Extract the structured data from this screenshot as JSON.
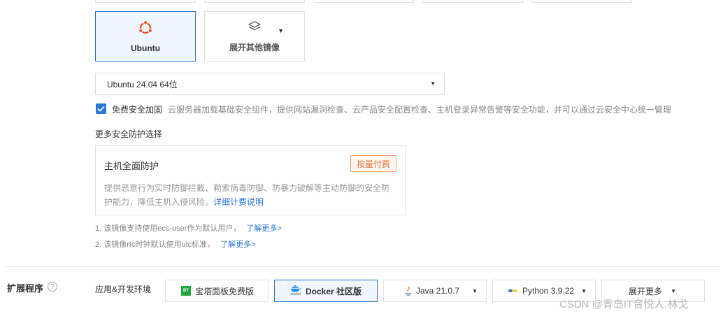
{
  "image_cards": {
    "ubuntu": {
      "label": "Ubuntu",
      "icon": "ubuntu-logo-icon",
      "color": "#e95420"
    },
    "other": {
      "label": "展开其他镜像",
      "icon": "layers-icon"
    }
  },
  "version_select": {
    "value": "Ubuntu 24.04 64位"
  },
  "security": {
    "checkbox_label": "免费安全加固",
    "checked": true,
    "description": "云服务器加载基础安全组件，提供网站漏洞检查、云产品安全配置检查、主机登录异常告警等安全功能，并可以通过云安全中心统一管理"
  },
  "more_protection": {
    "title": "更多安全防护选择",
    "card": {
      "title": "主机全面防护",
      "badge": "按量付费",
      "desc_line1": "提供恶意行为实时防御拦截、勒索病毒防御、防暴力破解等主动防御的安全防",
      "desc_line2": "护能力，降低主机入侵风险。",
      "link": "详细计费说明"
    }
  },
  "notes": [
    {
      "text": "1. 该镜像支持使用ecs-user作为默认用户，",
      "link": "了解更多>"
    },
    {
      "text": "2. 该镜像rtc时钟默认使用utc标准，",
      "link": "了解更多>"
    }
  ],
  "extensions": {
    "title": "扩展程序",
    "help": "?",
    "env_label": "应用&开发环境",
    "items": [
      {
        "label": "宝塔面板免费版",
        "icon_text": "BT"
      },
      {
        "label": "Docker 社区版",
        "icon_text": "docker",
        "selected": true
      },
      {
        "label": "Java 21.0.7"
      },
      {
        "label": "Python 3.9.22"
      },
      {
        "label": "展开更多"
      }
    ]
  },
  "watermark": "CSDN @青岛IT音悦人.林戈",
  "colors": {
    "accent": "#2a75d8",
    "pay_badge": "#e8733d"
  }
}
